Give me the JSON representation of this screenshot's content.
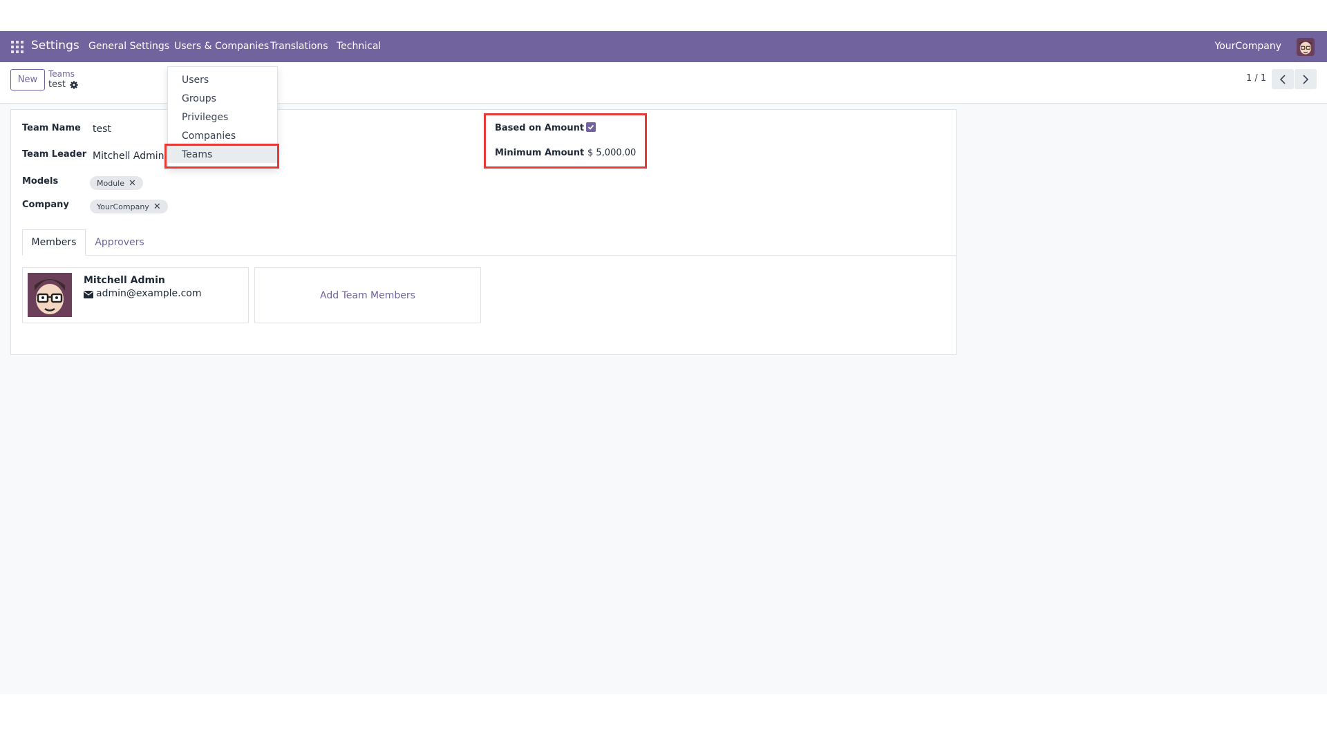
{
  "navbar": {
    "app_name": "Settings",
    "menu": [
      "General Settings",
      "Users & Companies",
      "Translations",
      "Technical"
    ],
    "company": "YourCompany",
    "bg_color": "#71639e"
  },
  "users_menu": {
    "items": [
      "Users",
      "Groups",
      "Privileges",
      "Companies",
      "Teams"
    ],
    "active": "Teams"
  },
  "control_panel": {
    "new_label": "New",
    "breadcrumb_parent": "Teams",
    "breadcrumb_current": "test",
    "pager": "1 / 1"
  },
  "form": {
    "team_name_label": "Team Name",
    "team_name_value": "test",
    "team_leader_label": "Team Leader",
    "team_leader_value": "Mitchell Admin",
    "models_label": "Models",
    "models_tag": "Module",
    "company_label": "Company",
    "company_tag": "YourCompany",
    "based_on_amount_label": "Based on Amount",
    "based_on_amount_checked": true,
    "minimum_amount_label": "Minimum Amount",
    "minimum_amount_value": "$ 5,000.00"
  },
  "tabs": [
    "Members",
    "Approvers"
  ],
  "members": [
    {
      "name": "Mitchell Admin",
      "email": "admin@example.com"
    }
  ],
  "add_members_label": "Add Team Members",
  "icons": {
    "apps": "apps-grid-icon",
    "gear": "gear-icon",
    "prev": "chevron-left-icon",
    "next": "chevron-right-icon",
    "mail": "envelope-icon",
    "remove": "close-icon",
    "check": "check-icon"
  },
  "colors": {
    "accent": "#71639e",
    "highlight": "#e53935"
  }
}
